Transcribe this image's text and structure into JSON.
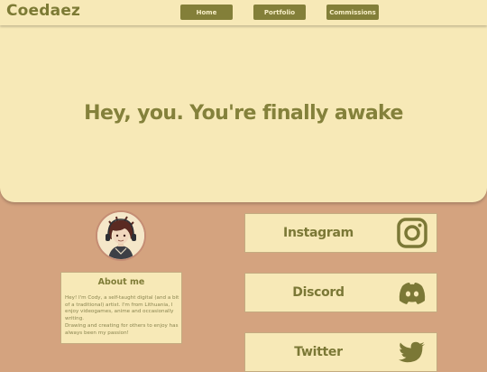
{
  "nav": {
    "brand": "Coedaez",
    "items": [
      {
        "label": "Home"
      },
      {
        "label": "Portfolio"
      },
      {
        "label": "Commissions"
      }
    ]
  },
  "hero": {
    "text": "Hey, you. You're finally awake"
  },
  "about": {
    "title": "About me",
    "body": "Hey! I'm Cody, a self-taught digital (and a bit of a traditional) artist. I'm from Lithuania, I enjoy videogames, anime and occasionally writing.\nDrawing and creating for others to enjoy has always been my passion!"
  },
  "socials": [
    {
      "label": "Instagram",
      "icon": "instagram-icon"
    },
    {
      "label": "Discord",
      "icon": "discord-icon"
    },
    {
      "label": "Twitter",
      "icon": "twitter-icon"
    }
  ],
  "colors": {
    "background": "#d4a37f",
    "panel": "#f7e9b7",
    "accent": "#837f39",
    "accent_text": "#f8efc8"
  }
}
